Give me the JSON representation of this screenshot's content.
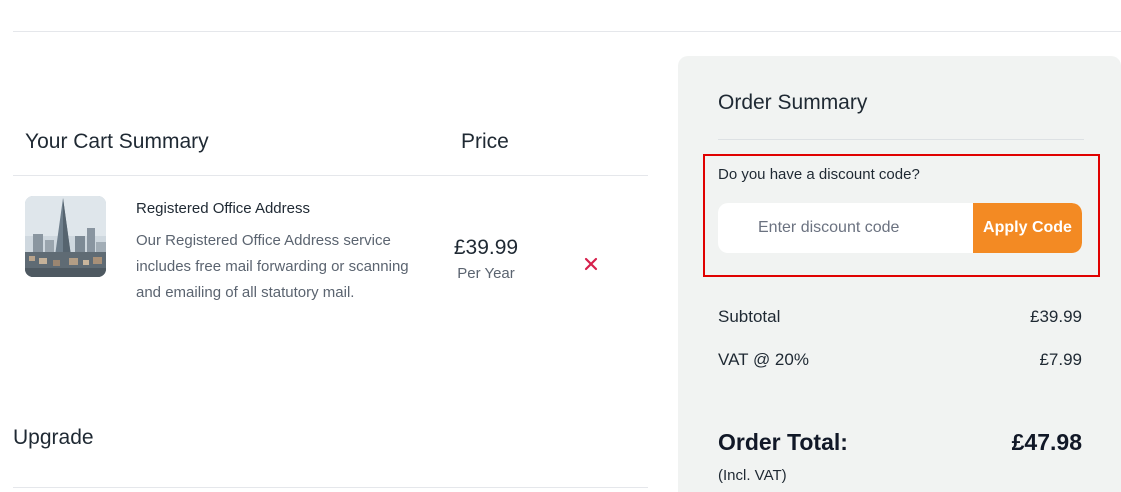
{
  "cart": {
    "heading": "Your Cart Summary",
    "price_heading": "Price",
    "item": {
      "title": "Registered Office Address",
      "description": "Our Registered Office Address service includes free mail forwarding or scanning and emailing of all statutory mail.",
      "price": "£39.99",
      "period": "Per Year",
      "remove_icon": "close-icon",
      "remove_color": "#d6204b",
      "thumbnail": "city-skyline-image"
    },
    "upgrade_heading": "Upgrade"
  },
  "summary": {
    "title": "Order Summary",
    "discount": {
      "question": "Do you have a discount code?",
      "placeholder": "Enter discount code",
      "value": "",
      "apply_label": "Apply Code",
      "apply_color": "#f38a23"
    },
    "subtotal_label": "Subtotal",
    "subtotal_value": "£39.99",
    "vat_label": "VAT @ 20%",
    "vat_value": "£7.99",
    "total_label": "Order Total:",
    "total_value": "£47.98",
    "total_note": "(Incl. VAT)"
  },
  "highlight_color": "#e00000"
}
